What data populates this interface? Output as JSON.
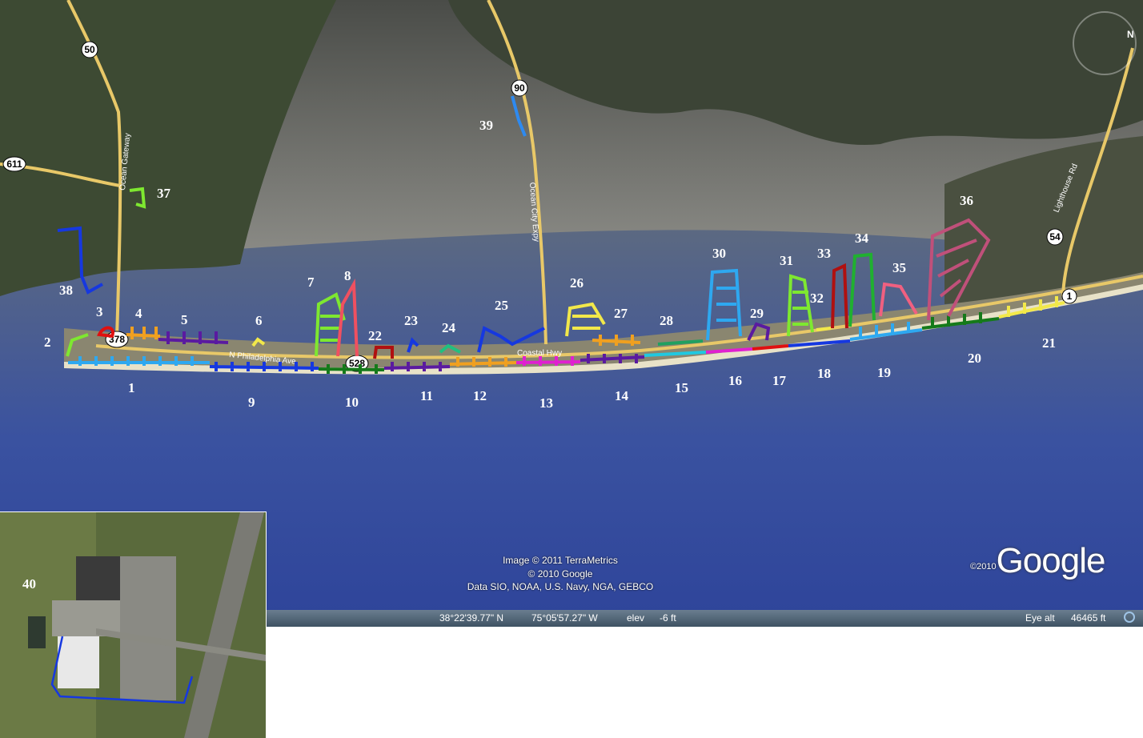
{
  "attribution": {
    "line1": "Image © 2011 TerraMetrics",
    "line2": "© 2010 Google",
    "line3": "Data SIO, NOAA, U.S. Navy, NGA, GEBCO"
  },
  "logo": {
    "year": "©2010",
    "name": "Google"
  },
  "status": {
    "latitude": "38°22'39.77\" N",
    "longitude": "75°05'57.27\" W",
    "elev_label": "elev",
    "elev_value": "-6 ft",
    "eye_alt_label": "Eye alt",
    "eye_alt_value": "46465 ft"
  },
  "nav": {
    "north": "N"
  },
  "roads": {
    "ocean_gateway": "Ocean Gateway",
    "n_philadelphia": "N Philadelphia Ave",
    "coastal_hwy": "Coastal Hwy",
    "ocean_city_expy": "Ocean City Expy",
    "lighthouse_rd": "Lighthouse Rd"
  },
  "shields": [
    "50",
    "611",
    "378",
    "528",
    "90",
    "54",
    "1"
  ],
  "zones": [
    "1",
    "2",
    "3",
    "4",
    "5",
    "6",
    "7",
    "8",
    "9",
    "10",
    "11",
    "12",
    "13",
    "14",
    "15",
    "16",
    "17",
    "18",
    "19",
    "20",
    "21",
    "22",
    "23",
    "24",
    "25",
    "26",
    "27",
    "28",
    "29",
    "30",
    "31",
    "32",
    "33",
    "34",
    "35",
    "36",
    "37",
    "38",
    "39"
  ],
  "inset": {
    "label": "40"
  },
  "colors": {
    "sky_blue": "#2ea8f0",
    "blue": "#1638e0",
    "dark_green": "#157a1a",
    "purple": "#5a1aa0",
    "orange": "#f0a020",
    "magenta": "#e020d0",
    "cyan": "#20c8e0",
    "lime": "#7ee830",
    "red": "#e01010",
    "yellow": "#f2e84a",
    "pink": "#e05888",
    "mauve": "#c0507a"
  }
}
